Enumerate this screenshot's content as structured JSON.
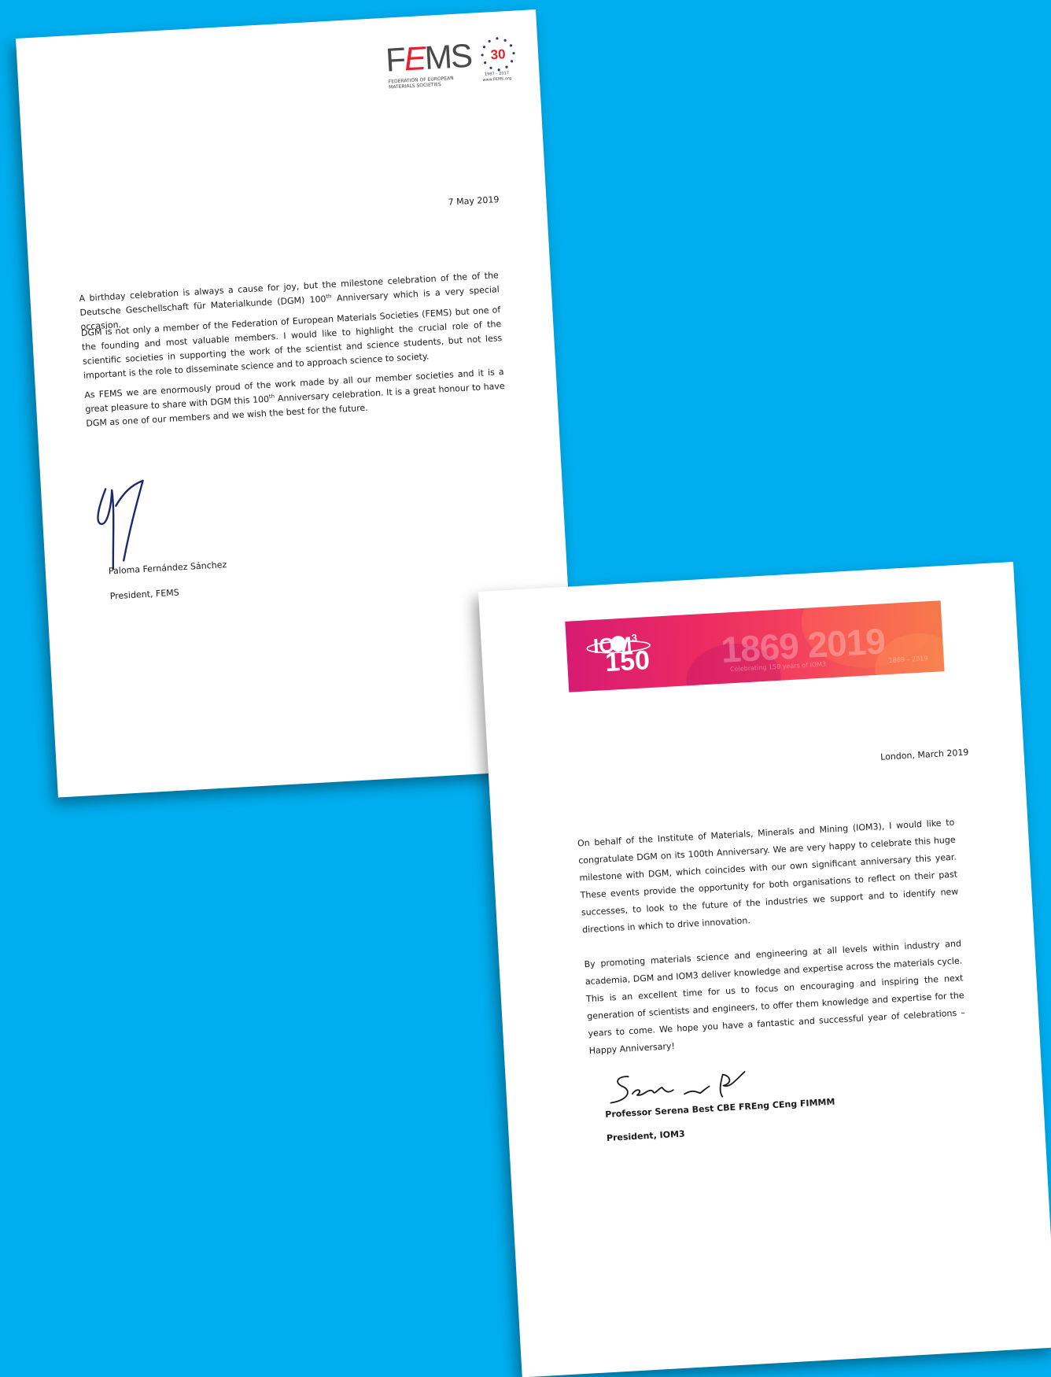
{
  "fems": {
    "logo_text": "FEMS",
    "logo_subtitle": "FEDERATION OF EUROPEAN MATERIALS SOCIETIES",
    "anniversary_number": "30",
    "anniversary_years": "1987 – 2017",
    "website": "www.FEMS.org",
    "date": "7 May 2019",
    "paragraph1": "A birthday celebration is always a cause for joy, but the milestone celebration of the of the Deutsche Geschellschaft für Materialkunde (DGM) 100",
    "paragraph1_sup": "th",
    "paragraph1_end": " Anniversary which is a very special occasion.",
    "paragraph2": "DGM is not only a member of the Federation of European Materials Societies (FEMS) but one of the founding and most valuable members. I would like to highlight the crucial role of the scientific societies in supporting the work of the scientist and science students, but not less important is the role to disseminate science and to approach science to society.",
    "paragraph3": "As FEMS we are enormously proud of the work made by all our member societies and it is a great pleasure to share with DGM this 100",
    "paragraph3_sup": "th",
    "paragraph3_end": " Anniversary celebration. It is a great honour to have DGM as one of our members and we wish the best for the future.",
    "signatory_name": "Paloma Fernández Sánchez",
    "signatory_title": "President, FEMS"
  },
  "iom": {
    "logo_text": "IOM",
    "logo_sup": "3",
    "logo_number": "150",
    "banner_years": "1869 2019",
    "banner_tagline": "Celebrating 150 years of IOM3",
    "banner_range": "1869 – 2019",
    "date": "London, March 2019",
    "paragraph1": "On behalf of the Institute of Materials, Minerals and Mining (IOM3), I would like to congratulate DGM on its 100th Anniversary. We are very happy to celebrate this huge milestone with DGM, which coincides with our own significant anniversary this year. These events provide the opportunity for both organisations to reflect on their past successes, to look to the future of the industries we support and to identify new directions in which to drive innovation.",
    "paragraph2": "By promoting materials science and engineering at all levels within industry and academia, DGM and IOM3 deliver knowledge and expertise across the materials cycle. This is an excellent time for us to focus on encouraging and inspiring the next generation of scientists and engineers, to offer them knowledge and expertise for the years to come. We hope you have a fantastic and successful year of celebrations – Happy Anniversary!",
    "signatory_name": "Professor Serena Best CBE FREng CEng FIMMM",
    "signatory_title": "President, IOM3"
  },
  "colors": {
    "background": "#00AEEF",
    "fems_red": "#e4202c",
    "signature_ink": "#1c2a6b",
    "iom_pink": "#ec2a62"
  }
}
